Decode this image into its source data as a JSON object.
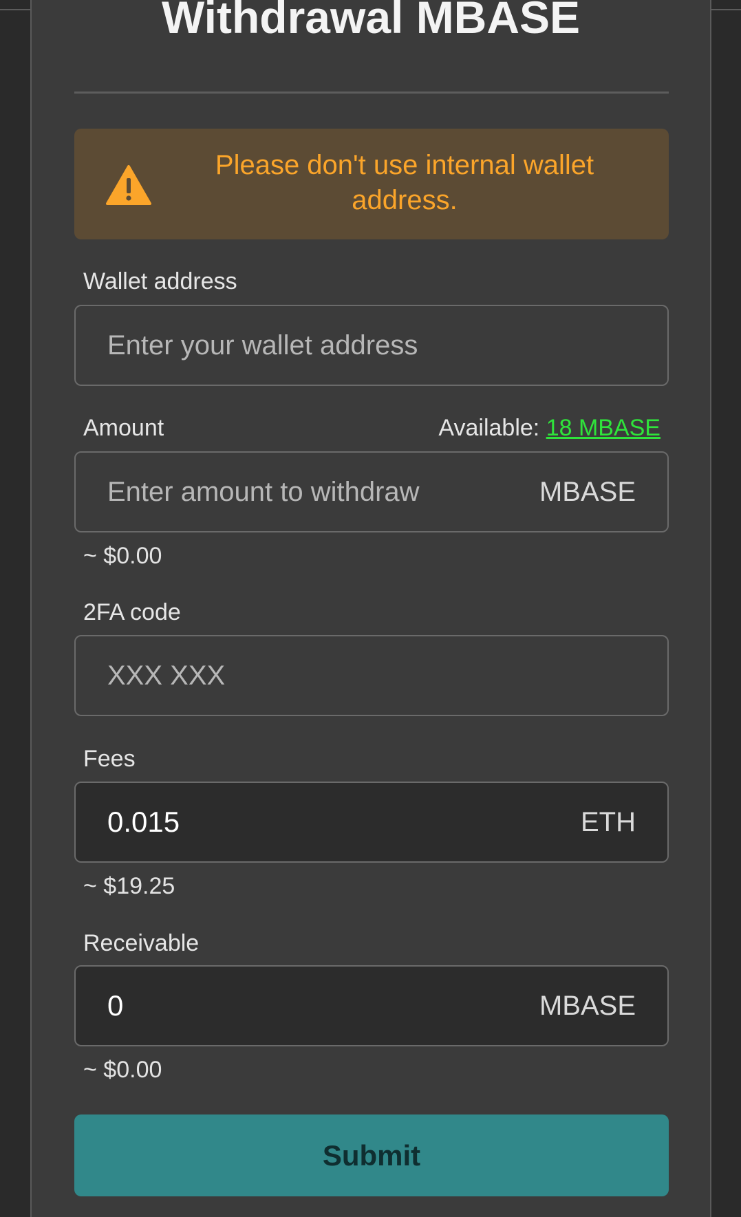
{
  "modal": {
    "title": "Withdrawal MBASE",
    "alert": {
      "icon": "warning-icon",
      "text": "Please don't use internal wallet address.",
      "color": "#fba52a"
    },
    "wallet": {
      "label": "Wallet address",
      "placeholder": "Enter your wallet address",
      "value": ""
    },
    "amount": {
      "label": "Amount",
      "available_label": "Available:",
      "available_value": "18 MBASE",
      "placeholder": "Enter amount to withdraw",
      "value": "",
      "suffix": "MBASE",
      "approx": "~ $0.00"
    },
    "twofa": {
      "label": "2FA code",
      "placeholder": "XXX XXX",
      "value": ""
    },
    "fees": {
      "label": "Fees",
      "value": "0.015",
      "suffix": "ETH",
      "approx": "~ $19.25"
    },
    "receivable": {
      "label": "Receivable",
      "value": "0",
      "suffix": "MBASE",
      "approx": "~ $0.00"
    },
    "submit_label": "Submit"
  },
  "colors": {
    "background": "#2a2a2a",
    "modal": "#3b3b3b",
    "alert_bg": "#5c4b34",
    "available_link": "#2fe43b",
    "submit_bg": "#31888a"
  }
}
